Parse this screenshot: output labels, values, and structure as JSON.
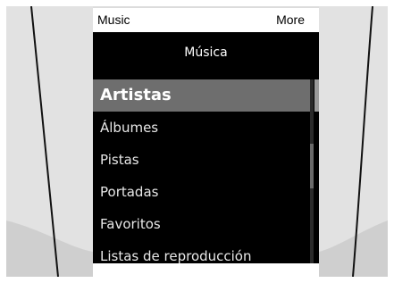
{
  "topbar": {
    "left_label": "Music",
    "right_label": "More"
  },
  "menu": {
    "title": "Música",
    "items": [
      {
        "label": "Artistas",
        "selected": true
      },
      {
        "label": "Álbumes",
        "selected": false
      },
      {
        "label": "Pistas",
        "selected": false
      },
      {
        "label": "Portadas",
        "selected": false
      },
      {
        "label": "Favoritos",
        "selected": false
      },
      {
        "label": "Listas de reproducción",
        "selected": false
      }
    ]
  },
  "colors": {
    "screen_background": "#000000",
    "selected_row": "#6e6e6e",
    "topbar_background": "#ffffff",
    "bezel": "#dcdcdc"
  }
}
